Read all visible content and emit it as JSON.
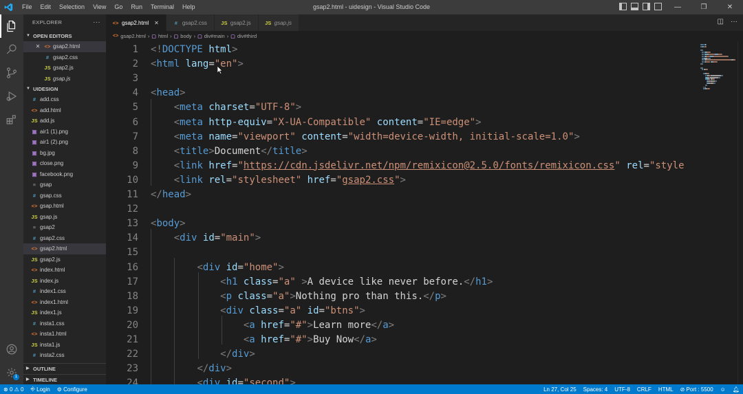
{
  "window": {
    "title": "gsap2.html - uidesign - Visual Studio Code",
    "menu": [
      "File",
      "Edit",
      "Selection",
      "View",
      "Go",
      "Run",
      "Terminal",
      "Help"
    ]
  },
  "sidebar": {
    "title": "EXPLORER",
    "open_editors_label": "OPEN EDITORS",
    "open_editors": [
      {
        "name": "gsap2.html",
        "type": "html",
        "icon": "<>",
        "close": "✕"
      },
      {
        "name": "gsap2.css",
        "type": "css",
        "icon": "#"
      },
      {
        "name": "gsap2.js",
        "type": "js",
        "icon": "JS"
      },
      {
        "name": "gsap.js",
        "type": "js",
        "icon": "JS",
        "italic": true
      }
    ],
    "folder_label": "UIDESIGN",
    "files": [
      {
        "name": "add.css",
        "type": "css",
        "icon": "#"
      },
      {
        "name": "add.html",
        "type": "html",
        "icon": "<>"
      },
      {
        "name": "add.js",
        "type": "js",
        "icon": "JS"
      },
      {
        "name": "air1 (1).png",
        "type": "img",
        "icon": "▣"
      },
      {
        "name": "air1 (2).png",
        "type": "img",
        "icon": "▣"
      },
      {
        "name": "bg.jpg",
        "type": "img",
        "icon": "▣"
      },
      {
        "name": "close.png",
        "type": "img",
        "icon": "▣"
      },
      {
        "name": "facebook.png",
        "type": "img",
        "icon": "▣"
      },
      {
        "name": "gsap",
        "type": "txt",
        "icon": "≡"
      },
      {
        "name": "gsap.css",
        "type": "css",
        "icon": "#"
      },
      {
        "name": "gsap.html",
        "type": "html",
        "icon": "<>"
      },
      {
        "name": "gsap.js",
        "type": "js",
        "icon": "JS"
      },
      {
        "name": "gsap2",
        "type": "txt",
        "icon": "≡"
      },
      {
        "name": "gsap2.css",
        "type": "css",
        "icon": "#"
      },
      {
        "name": "gsap2.html",
        "type": "html",
        "icon": "<>",
        "selected": true
      },
      {
        "name": "gsap2.js",
        "type": "js",
        "icon": "JS"
      },
      {
        "name": "index.html",
        "type": "html",
        "icon": "<>"
      },
      {
        "name": "index.js",
        "type": "js",
        "icon": "JS"
      },
      {
        "name": "index1.css",
        "type": "css",
        "icon": "#"
      },
      {
        "name": "index1.html",
        "type": "html",
        "icon": "<>"
      },
      {
        "name": "index1.js",
        "type": "js",
        "icon": "JS"
      },
      {
        "name": "insta1.css",
        "type": "css",
        "icon": "#"
      },
      {
        "name": "insta1.html",
        "type": "html",
        "icon": "<>"
      },
      {
        "name": "insta1.js",
        "type": "js",
        "icon": "JS"
      },
      {
        "name": "insta2.css",
        "type": "css",
        "icon": "#"
      }
    ],
    "outline_label": "OUTLINE",
    "timeline_label": "TIMELINE"
  },
  "tabs": [
    {
      "name": "gsap2.html",
      "type": "html",
      "icon": "<>",
      "active": true,
      "close": "✕"
    },
    {
      "name": "gsap2.css",
      "type": "css",
      "icon": "#"
    },
    {
      "name": "gsap2.js",
      "type": "js",
      "icon": "JS"
    },
    {
      "name": "gsap.js",
      "type": "js",
      "icon": "JS",
      "italic": true
    }
  ],
  "breadcrumb": [
    {
      "label": "gsap2.html",
      "icon": "<>"
    },
    {
      "label": "html",
      "icon": "▢"
    },
    {
      "label": "body",
      "icon": "▢"
    },
    {
      "label": "div#main",
      "icon": "▢"
    },
    {
      "label": "div#third",
      "icon": "▢"
    }
  ],
  "editor": {
    "lines": [
      {
        "n": "1",
        "tokens": [
          [
            "br",
            "<!"
          ],
          [
            "tag",
            "DOCTYPE"
          ],
          [
            "txt",
            " "
          ],
          [
            "attr",
            "html"
          ],
          [
            "br",
            ">"
          ]
        ]
      },
      {
        "n": "2",
        "tokens": [
          [
            "br",
            "<"
          ],
          [
            "tag",
            "html"
          ],
          [
            "txt",
            " "
          ],
          [
            "attr",
            "lang"
          ],
          [
            "txt",
            "="
          ],
          [
            "str",
            "\"en\""
          ],
          [
            "br",
            ">"
          ]
        ]
      },
      {
        "n": "3",
        "tokens": []
      },
      {
        "n": "4",
        "tokens": [
          [
            "br",
            "<"
          ],
          [
            "tag",
            "head"
          ],
          [
            "br",
            ">"
          ]
        ]
      },
      {
        "n": "5",
        "tokens": [
          [
            "txt",
            "    "
          ],
          [
            "br",
            "<"
          ],
          [
            "tag",
            "meta"
          ],
          [
            "txt",
            " "
          ],
          [
            "attr",
            "charset"
          ],
          [
            "txt",
            "="
          ],
          [
            "str",
            "\"UTF-8\""
          ],
          [
            "br",
            ">"
          ]
        ]
      },
      {
        "n": "6",
        "tokens": [
          [
            "txt",
            "    "
          ],
          [
            "br",
            "<"
          ],
          [
            "tag",
            "meta"
          ],
          [
            "txt",
            " "
          ],
          [
            "attr",
            "http-equiv"
          ],
          [
            "txt",
            "="
          ],
          [
            "str",
            "\"X-UA-Compatible\""
          ],
          [
            "txt",
            " "
          ],
          [
            "attr",
            "content"
          ],
          [
            "txt",
            "="
          ],
          [
            "str",
            "\"IE=edge\""
          ],
          [
            "br",
            ">"
          ]
        ]
      },
      {
        "n": "7",
        "tokens": [
          [
            "txt",
            "    "
          ],
          [
            "br",
            "<"
          ],
          [
            "tag",
            "meta"
          ],
          [
            "txt",
            " "
          ],
          [
            "attr",
            "name"
          ],
          [
            "txt",
            "="
          ],
          [
            "str",
            "\"viewport\""
          ],
          [
            "txt",
            " "
          ],
          [
            "attr",
            "content"
          ],
          [
            "txt",
            "="
          ],
          [
            "str",
            "\"width=device-width, initial-scale=1.0\""
          ],
          [
            "br",
            ">"
          ]
        ]
      },
      {
        "n": "8",
        "tokens": [
          [
            "txt",
            "    "
          ],
          [
            "br",
            "<"
          ],
          [
            "tag",
            "title"
          ],
          [
            "br",
            ">"
          ],
          [
            "txt",
            "Document"
          ],
          [
            "br",
            "</"
          ],
          [
            "tag",
            "title"
          ],
          [
            "br",
            ">"
          ]
        ]
      },
      {
        "n": "9",
        "tokens": [
          [
            "txt",
            "    "
          ],
          [
            "br",
            "<"
          ],
          [
            "tag",
            "link"
          ],
          [
            "txt",
            " "
          ],
          [
            "attr",
            "href"
          ],
          [
            "txt",
            "="
          ],
          [
            "str",
            "\""
          ],
          [
            "url",
            "https://cdn.jsdelivr.net/npm/remixicon@2.5.0/fonts/remixicon.css"
          ],
          [
            "str",
            "\""
          ],
          [
            "txt",
            " "
          ],
          [
            "attr",
            "rel"
          ],
          [
            "txt",
            "="
          ],
          [
            "str",
            "\"style"
          ]
        ]
      },
      {
        "n": "10",
        "tokens": [
          [
            "txt",
            "    "
          ],
          [
            "br",
            "<"
          ],
          [
            "tag",
            "link"
          ],
          [
            "txt",
            " "
          ],
          [
            "attr",
            "rel"
          ],
          [
            "txt",
            "="
          ],
          [
            "str",
            "\"stylesheet\""
          ],
          [
            "txt",
            " "
          ],
          [
            "attr",
            "href"
          ],
          [
            "txt",
            "="
          ],
          [
            "str",
            "\""
          ],
          [
            "url",
            "gsap2.css"
          ],
          [
            "str",
            "\""
          ],
          [
            "br",
            ">"
          ]
        ]
      },
      {
        "n": "11",
        "tokens": [
          [
            "br",
            "</"
          ],
          [
            "tag",
            "head"
          ],
          [
            "br",
            ">"
          ]
        ]
      },
      {
        "n": "12",
        "tokens": []
      },
      {
        "n": "13",
        "tokens": [
          [
            "br",
            "<"
          ],
          [
            "tag",
            "body"
          ],
          [
            "br",
            ">"
          ]
        ]
      },
      {
        "n": "14",
        "tokens": [
          [
            "txt",
            "    "
          ],
          [
            "br",
            "<"
          ],
          [
            "tag",
            "div"
          ],
          [
            "txt",
            " "
          ],
          [
            "attr",
            "id"
          ],
          [
            "txt",
            "="
          ],
          [
            "str",
            "\"main\""
          ],
          [
            "br",
            ">"
          ]
        ]
      },
      {
        "n": "15",
        "tokens": []
      },
      {
        "n": "16",
        "tokens": [
          [
            "txt",
            "        "
          ],
          [
            "br",
            "<"
          ],
          [
            "tag",
            "div"
          ],
          [
            "txt",
            " "
          ],
          [
            "attr",
            "id"
          ],
          [
            "txt",
            "="
          ],
          [
            "str",
            "\"home\""
          ],
          [
            "br",
            ">"
          ]
        ]
      },
      {
        "n": "17",
        "tokens": [
          [
            "txt",
            "            "
          ],
          [
            "br",
            "<"
          ],
          [
            "tag",
            "h1"
          ],
          [
            "txt",
            " "
          ],
          [
            "attr",
            "class"
          ],
          [
            "txt",
            "="
          ],
          [
            "str",
            "\"a\""
          ],
          [
            "txt",
            " "
          ],
          [
            "br",
            ">"
          ],
          [
            "txt",
            "A device like never before."
          ],
          [
            "br",
            "</"
          ],
          [
            "tag",
            "h1"
          ],
          [
            "br",
            ">"
          ]
        ]
      },
      {
        "n": "18",
        "tokens": [
          [
            "txt",
            "            "
          ],
          [
            "br",
            "<"
          ],
          [
            "tag",
            "p"
          ],
          [
            "txt",
            " "
          ],
          [
            "attr",
            "class"
          ],
          [
            "txt",
            "="
          ],
          [
            "str",
            "\"a\""
          ],
          [
            "br",
            ">"
          ],
          [
            "txt",
            "Nothing pro than this."
          ],
          [
            "br",
            "</"
          ],
          [
            "tag",
            "p"
          ],
          [
            "br",
            ">"
          ]
        ]
      },
      {
        "n": "19",
        "tokens": [
          [
            "txt",
            "            "
          ],
          [
            "br",
            "<"
          ],
          [
            "tag",
            "div"
          ],
          [
            "txt",
            " "
          ],
          [
            "attr",
            "class"
          ],
          [
            "txt",
            "="
          ],
          [
            "str",
            "\"a\""
          ],
          [
            "txt",
            " "
          ],
          [
            "attr",
            "id"
          ],
          [
            "txt",
            "="
          ],
          [
            "str",
            "\"btns\""
          ],
          [
            "br",
            ">"
          ]
        ]
      },
      {
        "n": "20",
        "tokens": [
          [
            "txt",
            "                "
          ],
          [
            "br",
            "<"
          ],
          [
            "tag",
            "a"
          ],
          [
            "txt",
            " "
          ],
          [
            "attr",
            "href"
          ],
          [
            "txt",
            "="
          ],
          [
            "str",
            "\"#\""
          ],
          [
            "br",
            ">"
          ],
          [
            "txt",
            "Learn more"
          ],
          [
            "br",
            "</"
          ],
          [
            "tag",
            "a"
          ],
          [
            "br",
            ">"
          ]
        ]
      },
      {
        "n": "21",
        "tokens": [
          [
            "txt",
            "                "
          ],
          [
            "br",
            "<"
          ],
          [
            "tag",
            "a"
          ],
          [
            "txt",
            " "
          ],
          [
            "attr",
            "href"
          ],
          [
            "txt",
            "="
          ],
          [
            "str",
            "\"#\""
          ],
          [
            "br",
            ">"
          ],
          [
            "txt",
            "Buy Now"
          ],
          [
            "br",
            "</"
          ],
          [
            "tag",
            "a"
          ],
          [
            "br",
            ">"
          ]
        ]
      },
      {
        "n": "22",
        "tokens": [
          [
            "txt",
            "            "
          ],
          [
            "br",
            "</"
          ],
          [
            "tag",
            "div"
          ],
          [
            "br",
            ">"
          ]
        ]
      },
      {
        "n": "23",
        "tokens": [
          [
            "txt",
            "        "
          ],
          [
            "br",
            "</"
          ],
          [
            "tag",
            "div"
          ],
          [
            "br",
            ">"
          ]
        ]
      },
      {
        "n": "24",
        "tokens": [
          [
            "txt",
            "        "
          ],
          [
            "br",
            "<"
          ],
          [
            "tag",
            "div"
          ],
          [
            "txt",
            " "
          ],
          [
            "attr",
            "id"
          ],
          [
            "txt",
            "="
          ],
          [
            "str",
            "\"second\""
          ],
          [
            "br",
            ">"
          ]
        ]
      }
    ]
  },
  "statusbar": {
    "errors": "0",
    "warnings": "0",
    "login": "Login",
    "configure": "Configure",
    "position": "Ln 27, Col 25",
    "spaces": "Spaces: 4",
    "encoding": "UTF-8",
    "eol": "CRLF",
    "language": "HTML",
    "port": "Port : 5500"
  },
  "colors": {
    "accent": "#007acc",
    "html_icon": "#e37933",
    "css_icon": "#519aba",
    "js_icon": "#cbcb41"
  }
}
